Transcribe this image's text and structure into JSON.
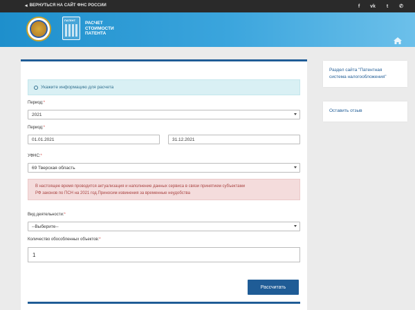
{
  "topbar": {
    "back_label": "ВЕРНУТЬСЯ НА САЙТ ФНС РОССИИ",
    "social": [
      {
        "icon": "facebook-icon",
        "glyph": "f"
      },
      {
        "icon": "vk-icon",
        "glyph": "vk"
      },
      {
        "icon": "twitter-icon",
        "glyph": "t"
      },
      {
        "icon": "phone-icon",
        "glyph": "✆"
      }
    ]
  },
  "header": {
    "logo_tag": "ПАТЕНТ",
    "title_line1": "РАСЧЕТ",
    "title_line2": "СТОИМОСТИ",
    "title_line3": "ПАТЕНТА"
  },
  "form": {
    "info_text": "Укажите информацию для расчета",
    "period_label": "Период:",
    "period_year": "2021",
    "period2_label": "Период:",
    "date_from": "01.01.2021",
    "date_to": "31.12.2021",
    "ufns_label": "УФНС:",
    "ufns_value": "69 Тверская область",
    "alert_line1": "В настоящее время проводится актуализация и наполнение данных сервиса в связи принятием субъектами",
    "alert_line2": "РФ законов по ПСН на 2021 год.Приносим извинения за временные неудобства",
    "activity_label": "Вид деятельности:",
    "activity_value": "--Выберите--",
    "objects_label": "Количество обособленных объектов:",
    "objects_value": "1",
    "required_mark": "*",
    "submit_label": "Рассчитать"
  },
  "sidebar": {
    "link1_line1": "Раздел сайта \"Патентная",
    "link1_line2": "система налогообложения\"",
    "link2": "Оставить отзыв"
  },
  "colors": {
    "accent": "#1f5c96",
    "header_gradient_start": "#1e8fcc",
    "info_bg": "#d9f0f4",
    "alert_bg": "#f4dcdc",
    "required": "#d9534f"
  }
}
